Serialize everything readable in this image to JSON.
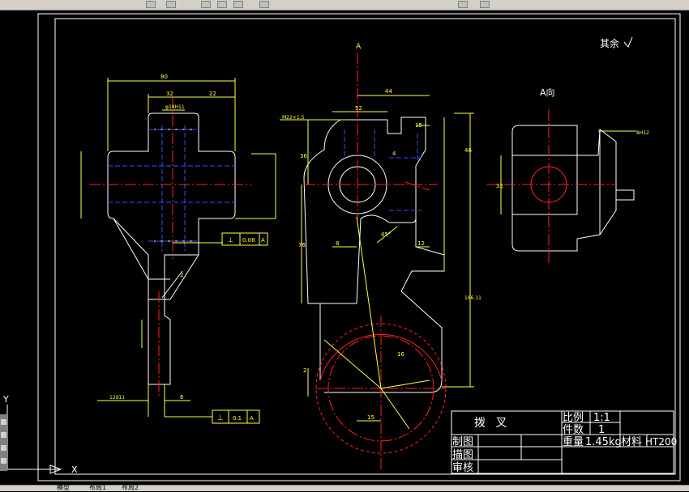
{
  "toolbar": {
    "labels": [
      "",
      ""
    ]
  },
  "drawing": {
    "roughness_note": "其余",
    "section_label": "A",
    "view_label": "A向",
    "dims": {
      "width_80": "80",
      "d_32": "32",
      "d_22": "22",
      "d_18h11": "φ18H11",
      "m22": "M22×1.5",
      "d_52": "52",
      "d_44": "44",
      "d_15": "15",
      "d_36": "36",
      "d_46": "46",
      "d_4": "4",
      "d_8": "8",
      "d_12": "12",
      "d_76": "76",
      "d_186": "186.11",
      "d_15m": "15",
      "d_32b": "32",
      "d_8h12": "8H12",
      "d_12d11": "12d11",
      "d_6": "6",
      "d_2": "2",
      "d_16": "16",
      "d_45": "45°"
    },
    "tolerance1": {
      "symbol": "⊥",
      "value": "0.08",
      "datum": "A"
    },
    "tolerance2": {
      "symbol": "⊥",
      "value": "0.1",
      "datum": "A"
    }
  },
  "title_block": {
    "name": "拨  叉",
    "scale_label": "比例",
    "scale_value": "1:1",
    "qty_label": "件数",
    "qty_value": "1",
    "weight_label": "重量",
    "weight_value": "1.45kg",
    "material_label": "材料",
    "material_value": "HT200",
    "drawn": "制图",
    "designed": "描图",
    "checked": "审核"
  },
  "ucs": {
    "x": "X",
    "y": "Y"
  },
  "tabs": {
    "items": [
      "模型",
      "布局1",
      "布局2"
    ]
  }
}
